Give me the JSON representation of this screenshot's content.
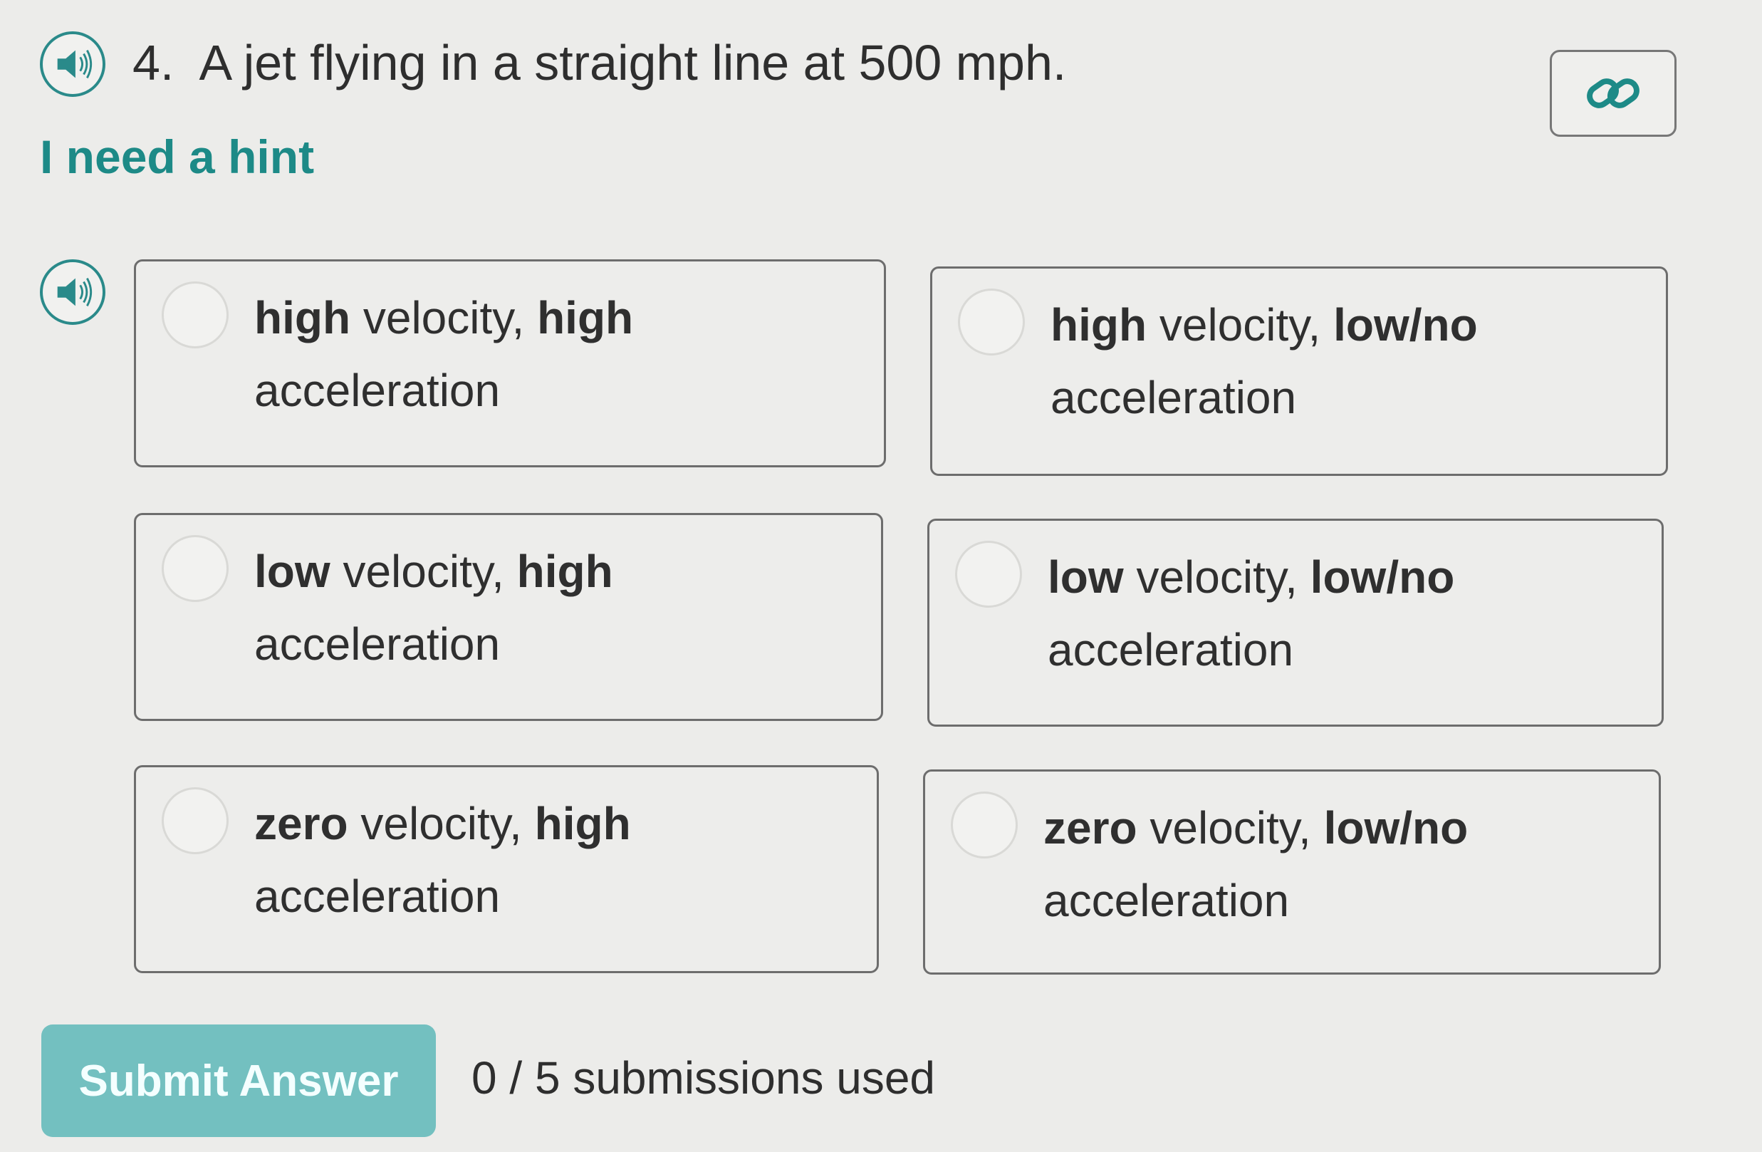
{
  "question": {
    "number": "4.",
    "text": "A jet flying in a straight line at 500 mph."
  },
  "hint_link": "I need a hint",
  "options": [
    {
      "part1": "high",
      "part2": " velocity, ",
      "part3": "high",
      "part4": "acceleration"
    },
    {
      "part1": "high",
      "part2": " velocity, ",
      "part3": "low/no",
      "part4": "acceleration"
    },
    {
      "part1": "low",
      "part2": " velocity, ",
      "part3": "high",
      "part4": "acceleration"
    },
    {
      "part1": "low",
      "part2": " velocity, ",
      "part3": "low/no",
      "part4": "acceleration"
    },
    {
      "part1": "zero",
      "part2": " velocity, ",
      "part3": "high",
      "part4": "acceleration"
    },
    {
      "part1": "zero",
      "part2": " velocity, ",
      "part3": "low/no",
      "part4": "acceleration"
    }
  ],
  "submit_label": "Submit Answer",
  "submissions_text": "0 / 5 submissions used",
  "icons": {
    "audio": "speaker-icon",
    "link": "link-icon"
  },
  "colors": {
    "accent": "#1d8a87",
    "submit_bg": "#73c0c0",
    "background": "#ececea"
  }
}
